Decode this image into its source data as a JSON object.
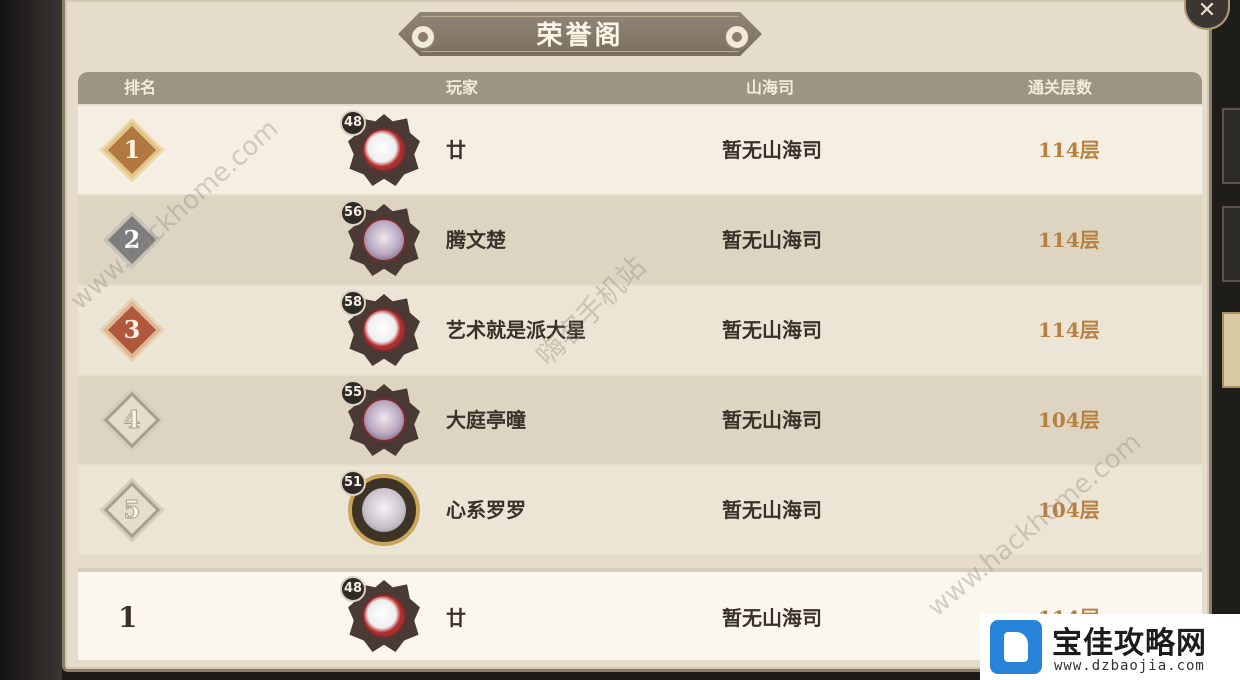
{
  "title": "荣誉阁",
  "close_icon_glyph": "✕",
  "columns": {
    "rank": "排名",
    "player": "玩家",
    "guild": "山海司",
    "floors": "通关层数"
  },
  "rows": [
    {
      "rank": "1",
      "level": "48",
      "name": "廿",
      "guild": "暂无山海司",
      "floors": "114层"
    },
    {
      "rank": "2",
      "level": "56",
      "name": "腾文楚",
      "guild": "暂无山海司",
      "floors": "114层"
    },
    {
      "rank": "3",
      "level": "58",
      "name": "艺术就是派大星",
      "guild": "暂无山海司",
      "floors": "114层"
    },
    {
      "rank": "4",
      "level": "55",
      "name": "大庭亭曈",
      "guild": "暂无山海司",
      "floors": "104层"
    },
    {
      "rank": "5",
      "level": "51",
      "name": "心系罗罗",
      "guild": "暂无山海司",
      "floors": "104层"
    }
  ],
  "my_row": {
    "rank": "1",
    "level": "48",
    "name": "廿",
    "guild": "暂无山海司",
    "floors": "114层"
  },
  "watermarks": {
    "hackhome": "www.hackhome.com",
    "hackhome_cn": "嗨客手机站"
  },
  "site_logo": {
    "brand": "宝佳攻略网",
    "url": "www.dzbaojia.com"
  }
}
